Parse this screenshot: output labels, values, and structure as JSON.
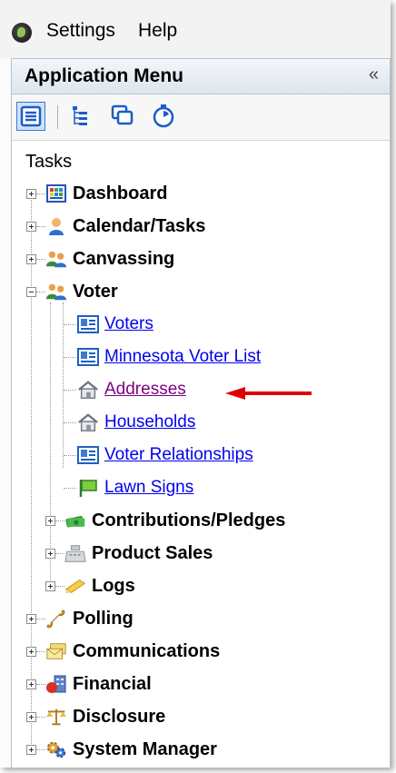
{
  "menubar": {
    "items": [
      {
        "label": "Settings"
      },
      {
        "label": "Help"
      }
    ]
  },
  "panel": {
    "title": "Application Menu",
    "collapse_glyph": "«"
  },
  "toolbar": {
    "buttons": [
      {
        "icon": "list-view-icon"
      },
      {
        "icon": "tree-view-icon"
      },
      {
        "icon": "windows-icon"
      },
      {
        "icon": "stopwatch-icon"
      }
    ]
  },
  "tasks": {
    "label": "Tasks",
    "tree": [
      {
        "label": "Dashboard",
        "icon": "dashboard-icon",
        "expanded": false
      },
      {
        "label": "Calendar/Tasks",
        "icon": "person-icon",
        "expanded": false
      },
      {
        "label": "Canvassing",
        "icon": "people-icon",
        "expanded": false
      },
      {
        "label": "Voter",
        "icon": "people-icon",
        "expanded": true,
        "children": [
          {
            "label": "Voters",
            "icon": "voter-card-icon",
            "type": "link"
          },
          {
            "label": "Minnesota Voter List",
            "icon": "voter-card-icon",
            "type": "link"
          },
          {
            "label": "Addresses",
            "icon": "house-icon",
            "type": "link",
            "visited": true
          },
          {
            "label": "Households",
            "icon": "house-icon",
            "type": "link"
          },
          {
            "label": "Voter Relationships",
            "icon": "voter-card-icon",
            "type": "link"
          },
          {
            "label": "Lawn Signs",
            "icon": "flag-icon",
            "type": "link"
          },
          {
            "label": "Contributions/Pledges",
            "icon": "money-icon",
            "type": "folder"
          },
          {
            "label": "Product Sales",
            "icon": "cash-register-icon",
            "type": "folder"
          },
          {
            "label": "Logs",
            "icon": "pencil-icon",
            "type": "folder"
          }
        ]
      },
      {
        "label": "Polling",
        "icon": "phone-icon",
        "expanded": false
      },
      {
        "label": "Communications",
        "icon": "envelopes-icon",
        "expanded": false
      },
      {
        "label": "Financial",
        "icon": "financial-icon",
        "expanded": false
      },
      {
        "label": "Disclosure",
        "icon": "scales-icon",
        "expanded": false
      },
      {
        "label": "System Manager",
        "icon": "gears-icon",
        "expanded": false
      }
    ]
  },
  "colors": {
    "link": "#0000ee",
    "visited_link": "#800080",
    "annotation_arrow": "#e00000"
  }
}
